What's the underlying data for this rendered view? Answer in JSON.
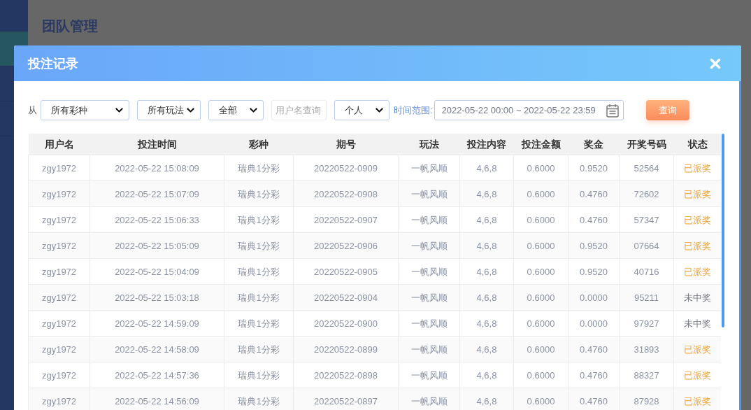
{
  "sidebar": {
    "items": [
      {
        "selected": false
      },
      {
        "selected": true
      },
      {
        "selected": false
      },
      {
        "selected": false
      }
    ]
  },
  "page": {
    "title": "团队管理"
  },
  "dialog": {
    "title": "投注记录",
    "filters": [
      {
        "kind": "label",
        "text": "从"
      },
      {
        "kind": "select",
        "value": "所有彩种"
      },
      {
        "kind": "select",
        "value": "所有玩法"
      },
      {
        "kind": "select",
        "value": "全部"
      },
      {
        "kind": "input",
        "placeholder": "用户名查询"
      },
      {
        "kind": "select",
        "value": "个人"
      },
      {
        "kind": "range-label",
        "text": "时间范围:"
      },
      {
        "kind": "date-range",
        "value": "2022-05-22 00:00 ~ 2022-05-22 23:59"
      },
      {
        "kind": "button",
        "label": "查询"
      }
    ],
    "table": {
      "columns": [
        "用户名",
        "投注时间",
        "彩种",
        "期号",
        "玩法",
        "投注内容",
        "投注金额",
        "奖金",
        "开奖号码",
        "状态"
      ],
      "rows": [
        {
          "cells": [
            "zgy1972",
            "2022-05-22 15:08:09",
            "瑞典1分彩",
            "20220522-0909",
            "一帆风顺",
            "4,6,8",
            "0.6000",
            "0.9520",
            "52564"
          ],
          "status": "已派奖",
          "won": true
        },
        {
          "cells": [
            "zgy1972",
            "2022-05-22 15:07:09",
            "瑞典1分彩",
            "20220522-0908",
            "一帆风顺",
            "4,6,8",
            "0.6000",
            "0.4760",
            "72602"
          ],
          "status": "已派奖",
          "won": true
        },
        {
          "cells": [
            "zgy1972",
            "2022-05-22 15:06:33",
            "瑞典1分彩",
            "20220522-0907",
            "一帆风顺",
            "4,6,8",
            "0.6000",
            "0.4760",
            "57347"
          ],
          "status": "已派奖",
          "won": true
        },
        {
          "cells": [
            "zgy1972",
            "2022-05-22 15:05:09",
            "瑞典1分彩",
            "20220522-0906",
            "一帆风顺",
            "4,6,8",
            "0.6000",
            "0.9520",
            "07664"
          ],
          "status": "已派奖",
          "won": true
        },
        {
          "cells": [
            "zgy1972",
            "2022-05-22 15:04:09",
            "瑞典1分彩",
            "20220522-0905",
            "一帆风顺",
            "4,6,8",
            "0.6000",
            "0.9520",
            "40716"
          ],
          "status": "已派奖",
          "won": true
        },
        {
          "cells": [
            "zgy1972",
            "2022-05-22 15:03:18",
            "瑞典1分彩",
            "20220522-0904",
            "一帆风顺",
            "4,6,8",
            "0.6000",
            "0.0000",
            "95211"
          ],
          "status": "未中奖",
          "won": false
        },
        {
          "cells": [
            "zgy1972",
            "2022-05-22 14:59:09",
            "瑞典1分彩",
            "20220522-0900",
            "一帆风顺",
            "4,6,8",
            "0.6000",
            "0.0000",
            "97927"
          ],
          "status": "未中奖",
          "won": false
        },
        {
          "cells": [
            "zgy1972",
            "2022-05-22 14:58:09",
            "瑞典1分彩",
            "20220522-0899",
            "一帆风顺",
            "4,6,8",
            "0.6000",
            "0.4760",
            "31893"
          ],
          "status": "已派奖",
          "won": true
        },
        {
          "cells": [
            "zgy1972",
            "2022-05-22 14:57:36",
            "瑞典1分彩",
            "20220522-0898",
            "一帆风顺",
            "4,6,8",
            "0.6000",
            "0.4760",
            "88327"
          ],
          "status": "已派奖",
          "won": true
        },
        {
          "cells": [
            "zgy1972",
            "2022-05-22 14:56:09",
            "瑞典1分彩",
            "20220522-0897",
            "一帆风顺",
            "4,6,8",
            "0.6000",
            "0.4760",
            "87928"
          ],
          "status": "已派奖",
          "won": true
        }
      ]
    }
  }
}
